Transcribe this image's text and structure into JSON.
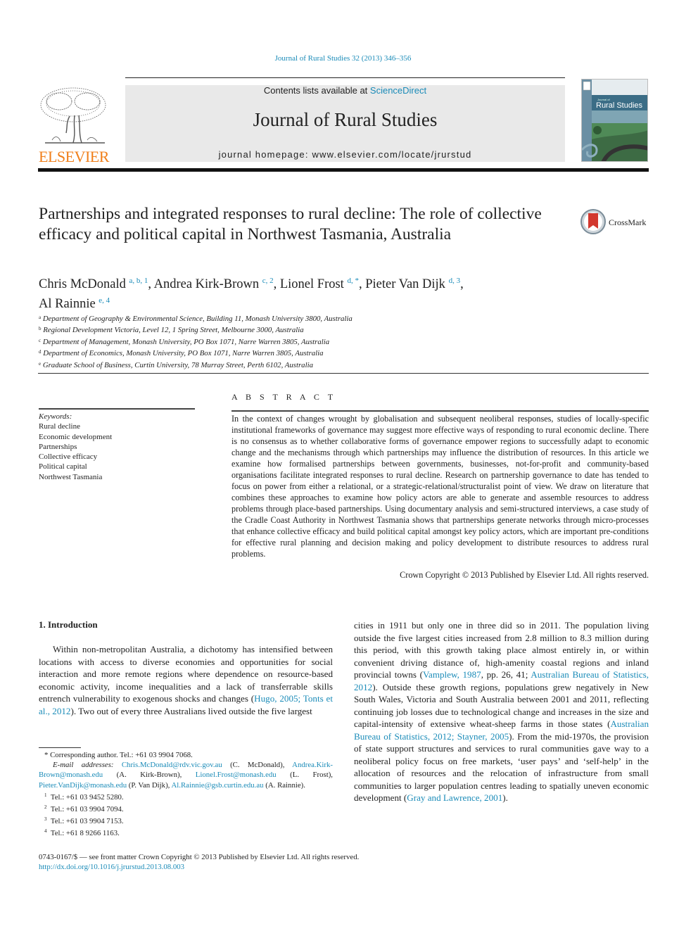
{
  "running_head": "Journal of Rural Studies 32 (2013) 346–356",
  "masthead": {
    "publisher_name": "ELSEVIER",
    "contents_prefix": "Contents lists available at ",
    "contents_link": "ScienceDirect",
    "journal_title": "Journal of Rural Studies",
    "homepage": "journal homepage: www.elsevier.com/locate/jrurstud",
    "cover_title": "Rural Studies",
    "cover_kicker": "Journal of"
  },
  "article": {
    "title": "Partnerships and integrated responses to rural decline: The role of collective efficacy and political capital in Northwest Tasmania, Australia",
    "crossmark_label": "CrossMark",
    "authors": [
      {
        "name": "Chris McDonald",
        "sup": "a, b, 1",
        "sep": ", "
      },
      {
        "name": "Andrea Kirk-Brown",
        "sup": "c, 2",
        "sep": ", "
      },
      {
        "name": "Lionel Frost",
        "sup": "d, *",
        "sep": ", "
      },
      {
        "name": "Pieter Van Dijk",
        "sup": "d, 3",
        "sep": ","
      },
      {
        "name": "Al Rainnie",
        "sup": "e, 4",
        "sep": ""
      }
    ],
    "affiliations": [
      {
        "key": "a",
        "text": "Department of Geography & Environmental Science, Building 11, Monash University 3800, Australia"
      },
      {
        "key": "b",
        "text": "Regional Development Victoria, Level 12, 1 Spring Street, Melbourne 3000, Australia"
      },
      {
        "key": "c",
        "text": "Department of Management, Monash University, PO Box 1071, Narre Warren 3805, Australia"
      },
      {
        "key": "d",
        "text": "Department of Economics, Monash University, PO Box 1071, Narre Warren 3805, Australia"
      },
      {
        "key": "e",
        "text": "Graduate School of Business, Curtin University, 78 Murray Street, Perth 6102, Australia"
      }
    ]
  },
  "keywords": {
    "label": "Keywords:",
    "items": [
      "Rural decline",
      "Economic development",
      "Partnerships",
      "Collective efficacy",
      "Political capital",
      "Northwest Tasmania"
    ]
  },
  "abstract": {
    "heading": "A B S T R A C T",
    "text": "In the context of changes wrought by globalisation and subsequent neoliberal responses, studies of locally-specific institutional frameworks of governance may suggest more effective ways of responding to rural economic decline. There is no consensus as to whether collaborative forms of governance empower regions to successfully adapt to economic change and the mechanisms through which partnerships may influence the distribution of resources. In this article we examine how formalised partnerships between governments, businesses, not-for-profit and community-based organisations facilitate integrated responses to rural decline. Research on partnership governance to date has tended to focus on power from either a relational, or a strategic-relational/structuralist point of view. We draw on literature that combines these approaches to examine how policy actors are able to generate and assemble resources to address problems through place-based partnerships. Using documentary analysis and semi-structured interviews, a case study of the Cradle Coast Authority in Northwest Tasmania shows that partnerships generate networks through micro-processes that enhance collective efficacy and build political capital amongst key policy actors, which are important pre-conditions for effective rural planning and decision making and policy development to distribute resources to address rural problems.",
    "copyright": "Crown Copyright © 2013 Published by Elsevier Ltd. All rights reserved."
  },
  "introduction": {
    "heading": "1.  Introduction",
    "left": {
      "t1": "Within non-metropolitan Australia, a dichotomy has intensified between locations with access to diverse economies and opportunities for social interaction and more remote regions where dependence on resource-based economic activity, income inequalities and a lack of transferrable skills entrench vulnerability to exogenous shocks and changes (",
      "c1": "Hugo, 2005; Tonts et al., 2012",
      "t2": "). Two out of every three Australians lived outside the five largest"
    },
    "right": {
      "t1": "cities in 1911 but only one in three did so in 2011. The population living outside the five largest cities increased from 2.8 million to 8.3 million during this period, with this growth taking place almost entirely in, or within convenient driving distance of, high-amenity coastal regions and inland provincial towns (",
      "c1": "Vamplew, 1987",
      "t2": ", pp. 26, 41; ",
      "c2": "Australian Bureau of Statistics, 2012",
      "t3": "). Outside these growth regions, populations grew negatively in New South Wales, Victoria and South Australia between 2001 and 2011, reflecting continuing job losses due to technological change and increases in the size and capital-intensity of extensive wheat-sheep farms in those states (",
      "c3": "Australian Bureau of Statistics, 2012; Stayner, 2005",
      "t4": "). From the mid-1970s, the provision of state support structures and services to rural communities gave way to a neoliberal policy focus on free markets, ‘user pays’ and ‘self-help’ in the allocation of resources and the relocation of infrastructure from small communities to larger population centres leading to spatially uneven economic development (",
      "c4": "Gray and Lawrence, 2001",
      "t5": ")."
    }
  },
  "footnotes": {
    "corresponding": "*  Corresponding author. Tel.: +61 03 9904 7068.",
    "email_label": "E-mail addresses:",
    "emails": [
      {
        "addr": "Chris.McDonald@rdv.vic.gov.au",
        "who": " (C. McDonald), "
      },
      {
        "addr": "Andrea.Kirk-Brown@monash.edu",
        "who": " (A. Kirk-Brown), "
      },
      {
        "addr": "Lionel.Frost@monash.edu",
        "who": " (L. Frost), "
      },
      {
        "addr": "Pieter.VanDijk@monash.edu",
        "who": " (P. Van Dijk), "
      },
      {
        "addr": "Al.Rainnie@gsb.curtin.edu.au",
        "who": " (A. Rainnie)."
      }
    ],
    "phones": [
      {
        "key": "1",
        "text": "Tel.: +61 03 9452 5280."
      },
      {
        "key": "2",
        "text": "Tel.: +61 03 9904 7094."
      },
      {
        "key": "3",
        "text": "Tel.: +61 03 9904 7153."
      },
      {
        "key": "4",
        "text": "Tel.: +61 8 9266 1163."
      }
    ]
  },
  "front_matter": "0743-0167/$ — see front matter Crown Copyright © 2013 Published by Elsevier Ltd. All rights reserved.",
  "doi": "http://dx.doi.org/10.1016/j.jrurstud.2013.08.003",
  "colors": {
    "link": "#1a8bb8",
    "elsevier_orange": "#f07f1a",
    "masthead_bg": "#e9e9e9"
  }
}
